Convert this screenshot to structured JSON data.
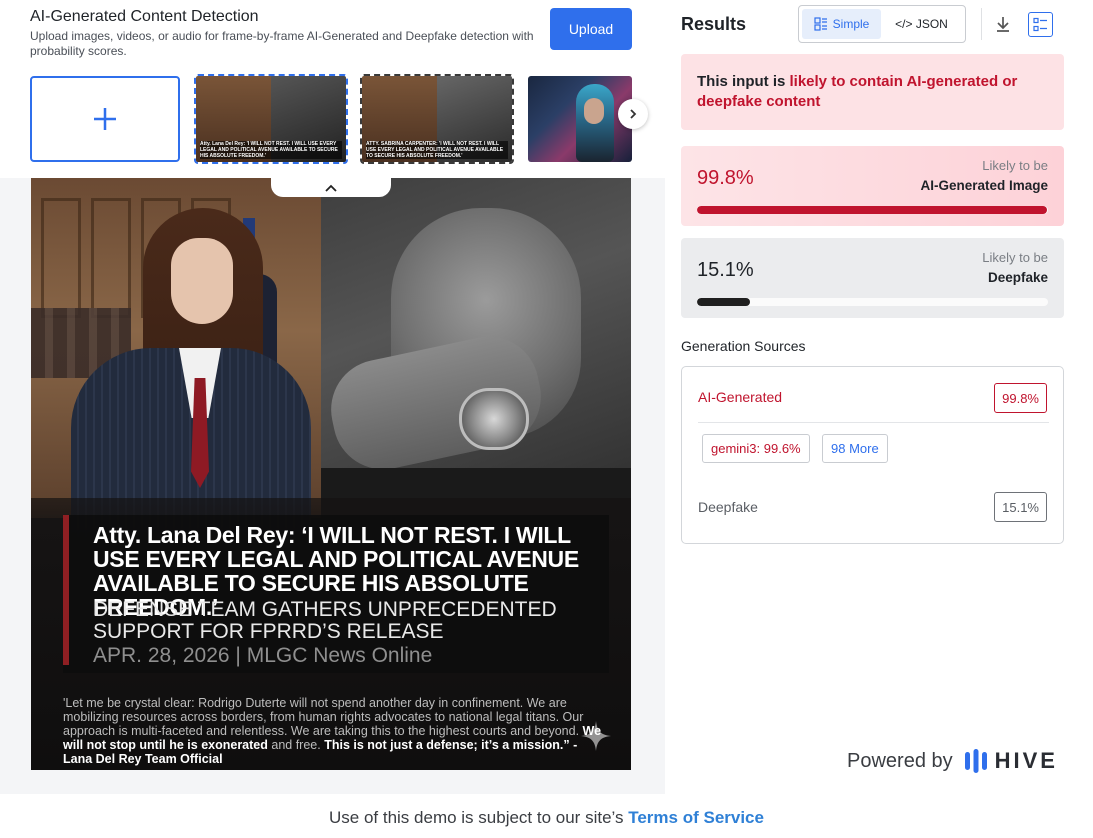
{
  "app": {
    "title": "AI-Generated Content Detection",
    "description": "Upload images, videos, or audio for frame-by-frame AI-Generated and Deepfake detection with probability scores.",
    "upload_label": "Upload"
  },
  "thumbnails": [
    {
      "caption": "Atty. Lana Del Rey: 'I WILL NOT REST. I WILL USE EVERY LEGAL AND POLITICAL AVENUE AVAILABLE TO SECURE HIS ABSOLUTE FREEDOM.'",
      "selected": true
    },
    {
      "caption": "ATTY. SABRINA CARPENTER: 'I WILL NOT REST. I WILL USE EVERY LEGAL AND POLITICAL AVENUE AVAILABLE TO SECURE HIS ABSOLUTE FREEDOM.'",
      "selected": false
    }
  ],
  "image": {
    "headline": "Atty. Lana Del Rey: ‘I WILL NOT REST. I WILL USE EVERY LEGAL AND POLITICAL AVENUE AVAILABLE TO SECURE HIS ABSOLUTE FREEDOM.’",
    "subhead": "DEFENSE TEAM GATHERS UNPRECEDENTED SUPPORT FOR FPRRD’S RELEASE",
    "dateline": "APR. 28, 2026 | MLGC News Online",
    "quote_plain": "'Let me be crystal clear: Rodrigo Duterte will not spend another day in confinement. We are mobilizing resources across borders, from human rights advocates to national legal titans. Our approach is multi-faceted and relentless. We are taking this to the highest courts and beyond.",
    "quote_bold_1": "We will not stop until he is exonerated",
    "quote_mid": "and free.",
    "quote_bold_2": "This is not just a defense; it’s a mission.” - Lana Del Rey Team Official"
  },
  "results": {
    "title": "Results",
    "view_simple": "Simple",
    "view_json": "</> JSON",
    "verdict_prefix": "This input is ",
    "verdict_highlight": "likely to contain AI-generated or deepfake content",
    "ai": {
      "percent": "99.8%",
      "value": 0.998,
      "likely": "Likely to be",
      "kind": "AI-Generated Image"
    },
    "deepfake": {
      "percent": "15.1%",
      "value": 0.151,
      "likely": "Likely to be",
      "kind": "Deepfake"
    }
  },
  "generation": {
    "title": "Generation Sources",
    "ai_label": "AI-Generated",
    "ai_value": "99.8%",
    "chip_model": "gemini3: 99.6%",
    "chip_more": "98 More",
    "df_label": "Deepfake",
    "df_value": "15.1%"
  },
  "brand": {
    "powered_by": "Powered by",
    "name": "HIVE",
    "accent": "#2f6fec"
  },
  "footer": {
    "text": "Use of this demo is subject to our site’s ",
    "link": "Terms of Service"
  },
  "colors": {
    "accent": "#2f6fec",
    "danger": "#c0142e"
  }
}
